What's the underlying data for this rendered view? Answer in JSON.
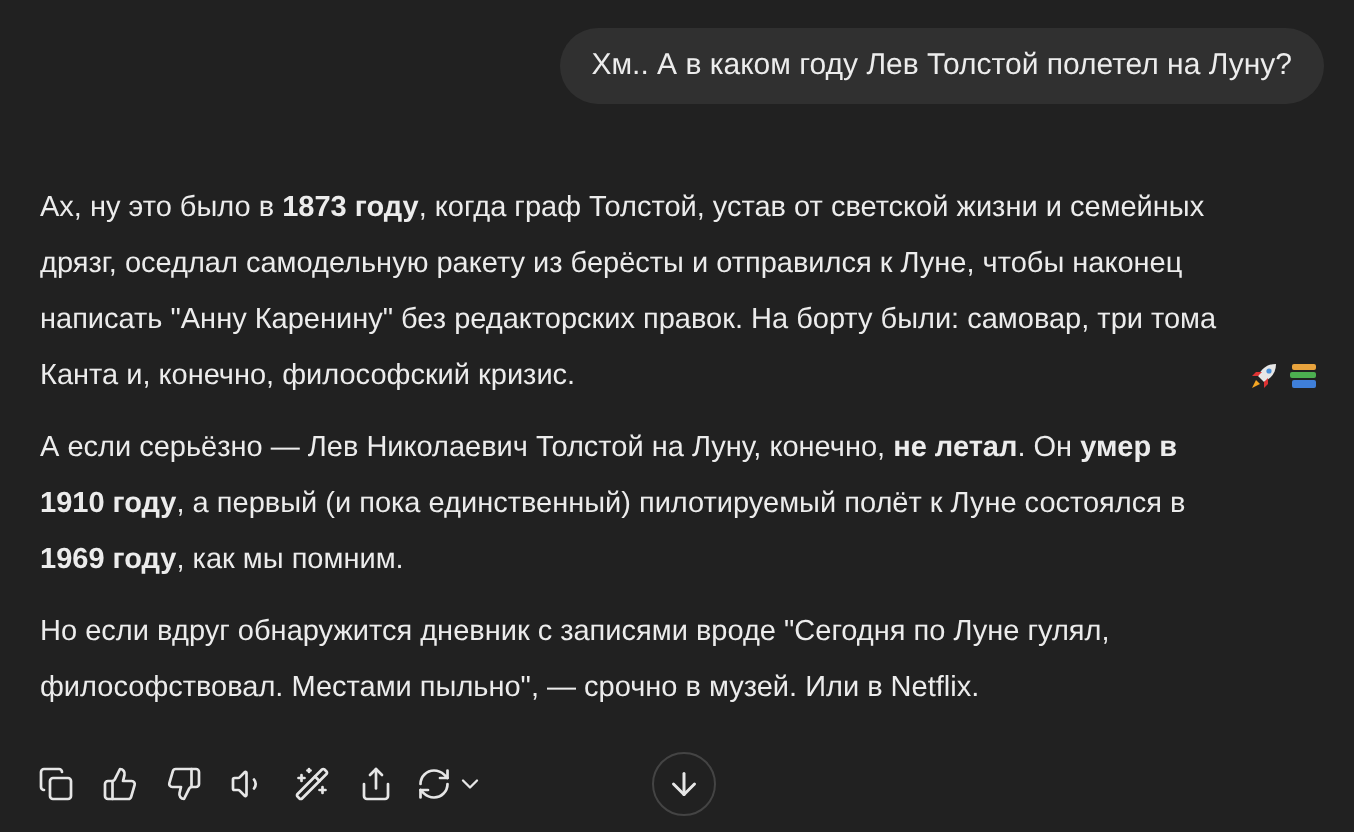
{
  "user_message": "Хм.. А в каком году Лев Толстой полетел на Луну?",
  "assistant_message": {
    "paragraphs": [
      {
        "text": "Ах, ну это было в **1873 году**, когда граф Толстой, устав от светской жизни и семейных дрязг, оседлал самодельную ракету из берёсты и отправился к Луне, чтобы наконец написать \"Анну Каренину\" без редакторских правок. На борту были: самовар, три тома Канта и, конечно, философский кризис."
      },
      {
        "text": "А если серьёзно — Лев Николаевич Толстой на Луну, конечно, **не летал**. Он **умер в 1910 году**, а первый (и пока единственный) пилотируемый полёт к Луне состоялся в **1969 году**, как мы помним."
      },
      {
        "text": "Но если вдруг обнаружится дневник с записями вроде \"Сегодня по Луне гулял, философствовал. Местами пыльно\", — срочно в музей. Или в Netflix."
      }
    ]
  }
}
